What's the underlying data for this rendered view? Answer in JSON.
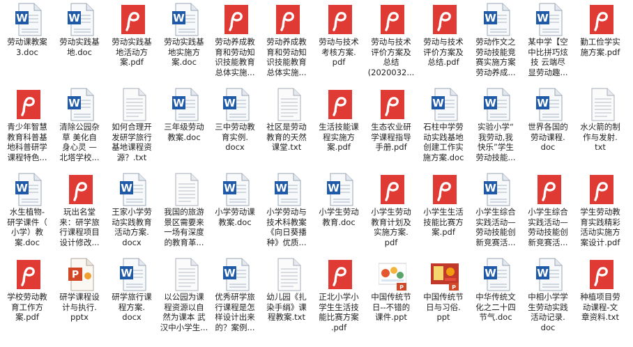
{
  "window_title": "",
  "files": [
    {
      "type": "doc",
      "lines": [
        "劳动课教案",
        "3.doc"
      ]
    },
    {
      "type": "doc",
      "lines": [
        "劳动实践基",
        "地.doc"
      ]
    },
    {
      "type": "pdf",
      "lines": [
        "劳动实践基",
        "地活动方",
        "案.pdf"
      ]
    },
    {
      "type": "doc",
      "lines": [
        "劳动实践基",
        "地实施方",
        "案.doc"
      ]
    },
    {
      "type": "pdf",
      "lines": [
        "劳动养成教",
        "育和劳动知",
        "识技能教育",
        "总体实施..."
      ]
    },
    {
      "type": "pdf",
      "lines": [
        "劳动养成教",
        "育和劳动知",
        "识技能教育",
        "总体实施..."
      ]
    },
    {
      "type": "pdf",
      "lines": [
        "劳动与技术",
        "考核方案.",
        "pdf"
      ]
    },
    {
      "type": "pdf",
      "lines": [
        "劳动与技术",
        "评价方案及",
        "总结",
        "(2020032..."
      ]
    },
    {
      "type": "pdf",
      "lines": [
        "劳动与技术",
        "评价方案及",
        "总结.pdf"
      ]
    },
    {
      "type": "doc",
      "lines": [
        "劳动作文之",
        "劳动技能竞",
        "赛实施方案",
        "劳动养成..."
      ]
    },
    {
      "type": "doc",
      "lines": [
        "某中学【空",
        "中比拼巧炫",
        "技 云端尽",
        "显劳动趣..."
      ]
    },
    {
      "type": "pdf",
      "lines": [
        "勤工俭学实",
        "施方案.pdf"
      ]
    },
    {
      "type": "pdf",
      "lines": [
        "青少年智慧",
        "教育科普基",
        "地科普研学",
        "课程特色..."
      ]
    },
    {
      "type": "doc",
      "lines": [
        "清除公园杂",
        "草 美化自",
        "身心灵 —",
        "北塔学校..."
      ]
    },
    {
      "type": "txt",
      "lines": [
        "如何合理开",
        "发研学旅行",
        "基地课程资",
        "源？.txt"
      ]
    },
    {
      "type": "doc",
      "lines": [
        "三年级劳动",
        "教案.doc"
      ]
    },
    {
      "type": "docx",
      "lines": [
        "三中劳动教",
        "育实例.",
        "docx"
      ]
    },
    {
      "type": "txt",
      "lines": [
        "社区是劳动",
        "教育的天然",
        "课堂.txt"
      ]
    },
    {
      "type": "pdf",
      "lines": [
        "生活技能课",
        "程实施方",
        "案.pdf"
      ]
    },
    {
      "type": "pdf",
      "lines": [
        "生态农业研",
        "学课程指导",
        "手册.pdf"
      ]
    },
    {
      "type": "doc",
      "lines": [
        "石柱中学劳",
        "动实践基地",
        "创建工作实",
        "施方案.doc"
      ]
    },
    {
      "type": "doc",
      "lines": [
        "实验小学“",
        "我劳动,我",
        "快乐”学生",
        "劳动技能..."
      ]
    },
    {
      "type": "doc",
      "lines": [
        "世界各国的",
        "劳动课程.",
        "doc"
      ]
    },
    {
      "type": "txt",
      "lines": [
        "水火箭的制",
        "作与发射.",
        "txt"
      ]
    },
    {
      "type": "doc",
      "lines": [
        "水生植物-",
        "研学课件（",
        "小学）教",
        "案.doc"
      ]
    },
    {
      "type": "pdf",
      "lines": [
        "玩出名堂",
        "来：研学旅",
        "行课程项目",
        "设计修改..."
      ]
    },
    {
      "type": "docx",
      "lines": [
        "王家小学劳",
        "动实践教育",
        "活动方案.",
        "docx"
      ]
    },
    {
      "type": "txt",
      "lines": [
        "我国的旅游",
        "景区需要来",
        "一场有深度",
        "的教育革..."
      ]
    },
    {
      "type": "doc",
      "lines": [
        "小学劳动课",
        "教案.doc"
      ]
    },
    {
      "type": "docx",
      "lines": [
        "小学劳动与",
        "技术科教案",
        "《向日葵播",
        "种》优质..."
      ]
    },
    {
      "type": "doc",
      "lines": [
        "小学生劳动",
        "教育.doc"
      ]
    },
    {
      "type": "pdf",
      "lines": [
        "小学生劳动",
        "教育计划及",
        "实施方案.",
        "pdf"
      ]
    },
    {
      "type": "pdf",
      "lines": [
        "小学生生活",
        "技能比赛方",
        "案.pdf"
      ]
    },
    {
      "type": "doc",
      "lines": [
        "小学生综合",
        "实践活动—",
        "劳动技能创",
        "新竞赛活..."
      ]
    },
    {
      "type": "pdf",
      "lines": [
        "小学生综合",
        "实践活动—",
        "劳动技能创",
        "新竞赛活..."
      ]
    },
    {
      "type": "pdf",
      "lines": [
        "学生劳动教",
        "育实践精彩",
        "活动实施方",
        "案设计.pdf"
      ]
    },
    {
      "type": "pdf",
      "lines": [
        "学校劳动教",
        "育工作方",
        "案.pdf"
      ]
    },
    {
      "type": "pptx",
      "lines": [
        "研学课程设",
        "计与执行.",
        "pptx"
      ]
    },
    {
      "type": "docx",
      "lines": [
        "研学旅行课",
        "程方案.",
        "docx"
      ]
    },
    {
      "type": "txt",
      "lines": [
        "以公园为课",
        "程资源以自",
        "然为课本 武",
        "汉中小学生..."
      ]
    },
    {
      "type": "doc",
      "lines": [
        "优秀研学旅",
        "行课程是怎",
        "样设计出来",
        "的？案例..."
      ]
    },
    {
      "type": "txt",
      "lines": [
        "幼儿园《扎",
        "染手绢》课",
        "程教案.txt"
      ]
    },
    {
      "type": "pdf",
      "lines": [
        "正北小学小",
        "学生生活技",
        "能比赛方案",
        ".pdf"
      ]
    },
    {
      "type": "ppt-thumb",
      "lines": [
        "中国传统节",
        "日--不错的",
        "课件.ppt"
      ]
    },
    {
      "type": "ppt-thumb2",
      "lines": [
        "中国传统节",
        "日与习俗.",
        "ppt"
      ]
    },
    {
      "type": "doc",
      "lines": [
        "中华传统文",
        "化之二十四",
        "节气.doc"
      ]
    },
    {
      "type": "doc",
      "lines": [
        "中相小学学",
        "生劳动实践",
        "活动记录.",
        "doc"
      ]
    },
    {
      "type": "pdf",
      "lines": [
        "种植项目劳",
        "动课程-文",
        "章资料.txt"
      ]
    }
  ]
}
